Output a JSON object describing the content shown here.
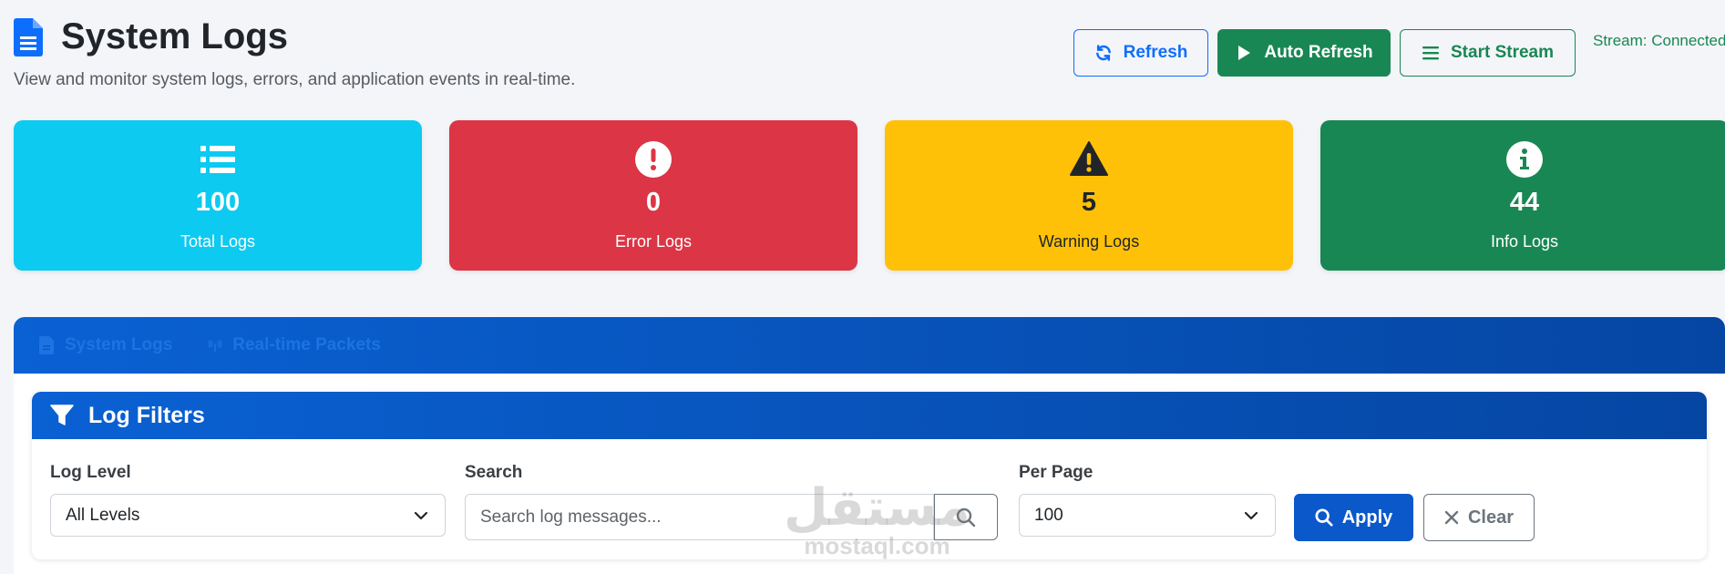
{
  "header": {
    "title": "System Logs",
    "subtitle": "View and monitor system logs, errors, and application events in real-time."
  },
  "actions": {
    "refresh_label": "Refresh",
    "auto_refresh_label": "Auto Refresh",
    "start_stream_label": "Start Stream",
    "stream_status": "Stream: Connected"
  },
  "stats": [
    {
      "value": "100",
      "label": "Total Logs",
      "icon": "list-icon",
      "color": "#0dcaf0"
    },
    {
      "value": "0",
      "label": "Error Logs",
      "icon": "exclamation-circle-icon",
      "color": "#dc3545"
    },
    {
      "value": "5",
      "label": "Warning Logs",
      "icon": "warning-triangle-icon",
      "color": "#ffc107"
    },
    {
      "value": "44",
      "label": "Info Logs",
      "icon": "info-circle-icon",
      "color": "#198754"
    }
  ],
  "tabs": [
    {
      "label": "System Logs",
      "icon": "file-icon"
    },
    {
      "label": "Real-time Packets",
      "icon": "antenna-icon"
    }
  ],
  "filters": {
    "title": "Log Filters",
    "log_level": {
      "label": "Log Level",
      "value": "All Levels"
    },
    "search": {
      "label": "Search",
      "placeholder": "Search log messages..."
    },
    "per_page": {
      "label": "Per Page",
      "value": "100"
    },
    "apply_label": "Apply",
    "clear_label": "Clear"
  },
  "watermark": {
    "logo": "مستقل",
    "text": "mostaql.com"
  },
  "colors": {
    "primary": "#0d6efd",
    "success": "#198754",
    "info": "#0dcaf0",
    "danger": "#dc3545",
    "warning": "#ffc107"
  }
}
